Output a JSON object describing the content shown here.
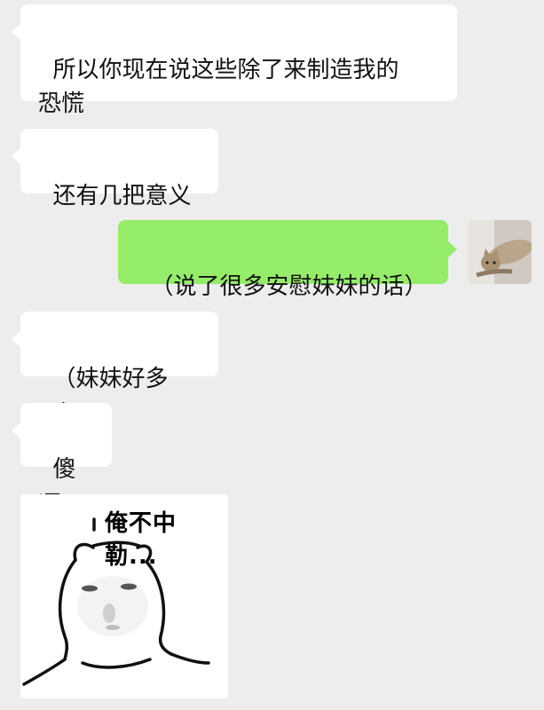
{
  "messages": [
    {
      "id": "m1",
      "direction": "incoming",
      "text": "所以你现在说这些除了来制造我的\n恐慌"
    },
    {
      "id": "m2",
      "direction": "incoming",
      "text": "还有几把意义"
    },
    {
      "id": "m3",
      "direction": "outgoing",
      "text": "（说了很多安慰妹妹的话）"
    },
    {
      "id": "m4",
      "direction": "incoming",
      "text": "（妹妹好多了）"
    },
    {
      "id": "m5",
      "direction": "incoming",
      "text": "傻逼"
    }
  ],
  "sticker": {
    "caption": "俺不中勒..."
  },
  "avatar": {
    "icon": "cat-photo-avatar"
  },
  "colors": {
    "background": "#ededed",
    "incoming_bubble": "#ffffff",
    "outgoing_bubble": "#95ec69"
  }
}
